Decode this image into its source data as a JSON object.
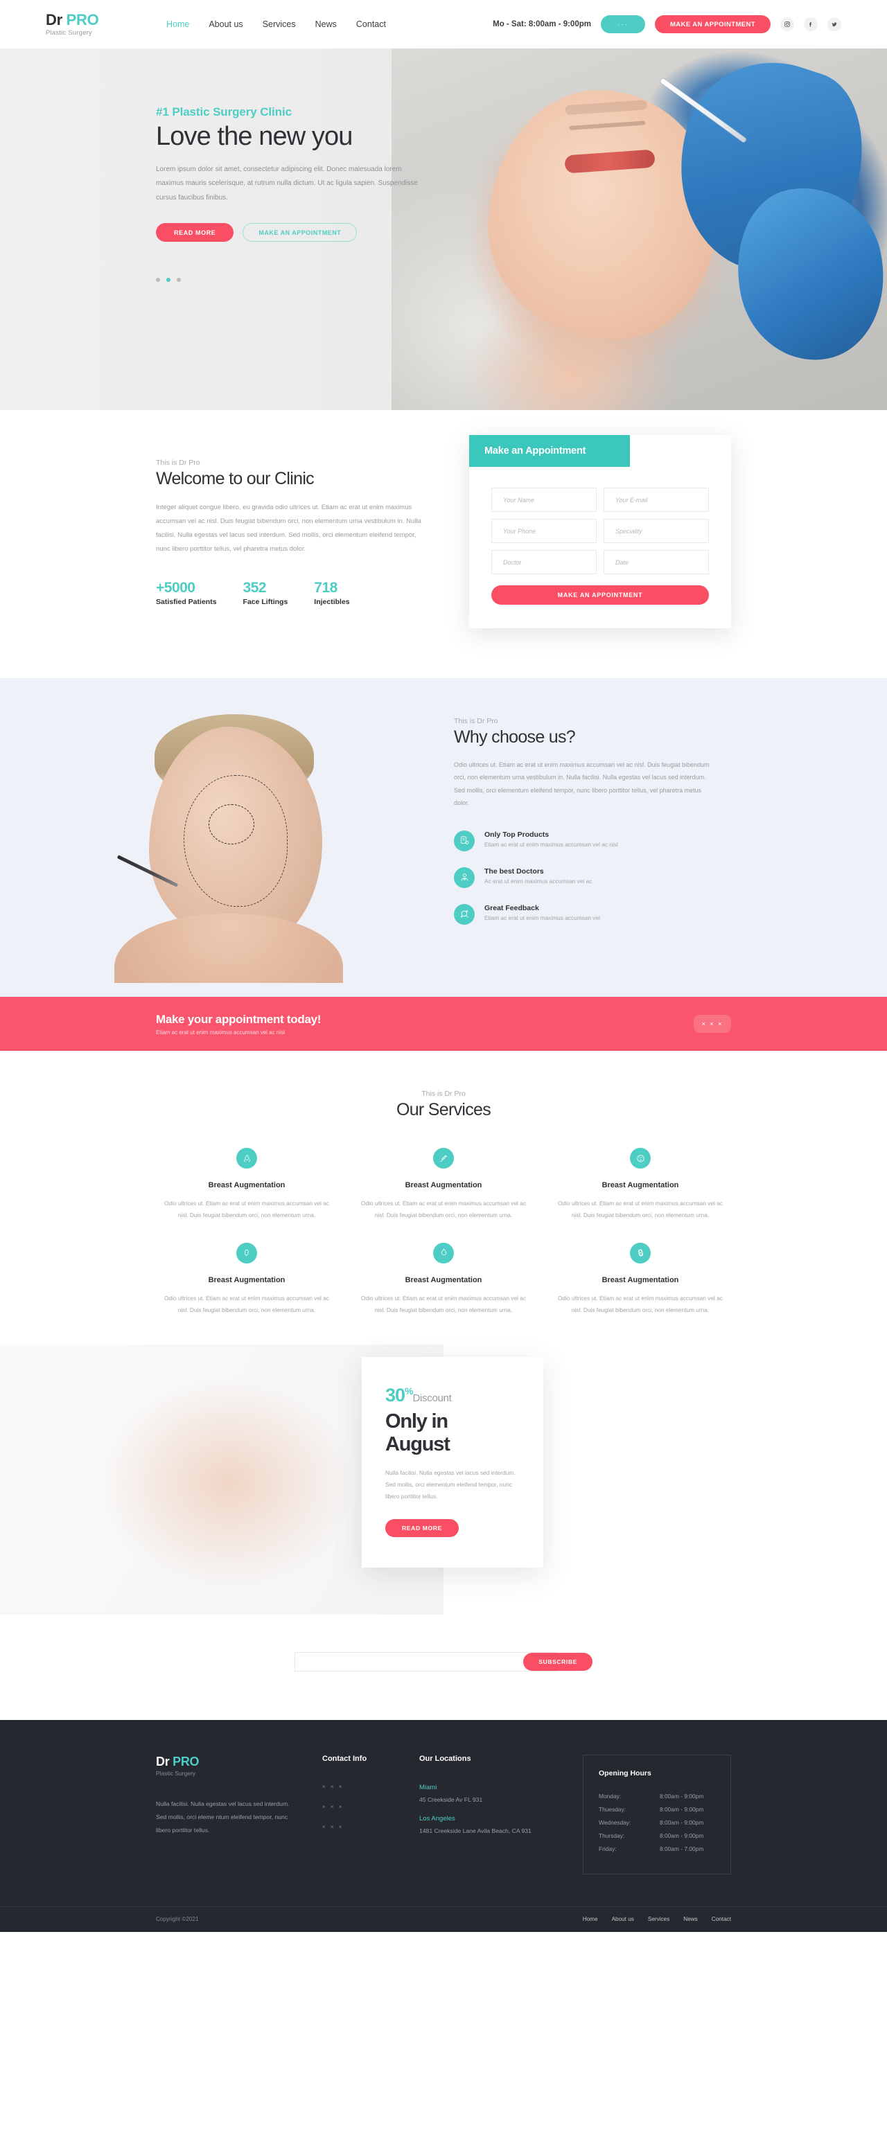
{
  "brand": {
    "name_first": "Dr",
    "name_second": "PRO",
    "tagline": "Plastic Surgery",
    "accent_teal": "#4ecdc4",
    "accent_pink": "#f94e63",
    "dark": "#25282e"
  },
  "header": {
    "nav": [
      {
        "label": "Home",
        "active": true
      },
      {
        "label": "About us",
        "active": false
      },
      {
        "label": "Services",
        "active": false
      },
      {
        "label": "News",
        "active": false
      },
      {
        "label": "Contact",
        "active": false
      }
    ],
    "hours": "Mo - Sat: 8:00am - 9:00pm",
    "dots_label": "···",
    "appointment_label": "MAKE AN APPOINTMENT",
    "socials": [
      {
        "name": "instagram-icon",
        "glyph": "□"
      },
      {
        "name": "facebook-icon",
        "glyph": "f"
      },
      {
        "name": "twitter-icon",
        "glyph": "✉"
      }
    ]
  },
  "hero": {
    "kicker": "#1 Plastic Surgery Clinic",
    "title": "Love the new you",
    "text": "Lorem ipsum dolor sit amet, consectetur adipiscing elit. Donec malesuada lorem maximus mauris scelerisque, at rutrum nulla dictum. Ut ac ligula sapien. Suspendisse cursus faucibus finibus.",
    "btn_primary": "READ MORE",
    "btn_secondary": "MAKE AN APPOINTMENT",
    "slider_active_index": 1,
    "slider_count": 3
  },
  "welcome": {
    "kicker": "This is Dr Pro",
    "title": "Welcome to our Clinic",
    "text": "Integer aliquet congue libero, eu gravida odio ultrices ut. Etiam ac erat ut enim maximus accumsan vel ac nisl. Duis feugiat bibendum orci, non elementum urna vestibulum in. Nulla facilisi. Nulla egestas vel lacus sed interdum. Sed mollis, orci elementum eleifend tempor, nunc libero porttitor tellus, vel pharetra metus dolor.",
    "stats": [
      {
        "value": "+5000",
        "label": "Satisfied Patients"
      },
      {
        "value": "352",
        "label": "Face Liftings"
      },
      {
        "value": "718",
        "label": "Injectibles"
      }
    ]
  },
  "appointment_form": {
    "heading": "Make an Appointment",
    "fields": [
      {
        "name": "name",
        "placeholder": "Your Name",
        "value": ""
      },
      {
        "name": "email",
        "placeholder": "Your E-mail",
        "value": ""
      },
      {
        "name": "phone",
        "placeholder": "Your Phone",
        "value": ""
      },
      {
        "name": "speciality",
        "placeholder": "Speciality",
        "value": ""
      },
      {
        "name": "doctor",
        "placeholder": "Doctor",
        "value": ""
      },
      {
        "name": "date",
        "placeholder": "Date",
        "value": ""
      }
    ],
    "submit_label": "MAKE AN APPOINTMENT"
  },
  "why": {
    "kicker": "This is Dr Pro",
    "title": "Why choose us?",
    "text": "Odio ultrices ut. Etiam ac erat ut enim maximus accumsan vel ac nisl. Duis feugiat bibendum orci, non elementum urna vestibulum in. Nulla facilisi. Nulla egestas vel lacus sed interdum. Sed mollis, orci elementum eleifend tempor, nunc libero porttitor tellus, vel pharetra metus dolor.",
    "features": [
      {
        "icon": "products-icon",
        "title": "Only Top Products",
        "sub": "Etiam ac erat ut enim maximus accumsan vel ac nisl"
      },
      {
        "icon": "doctor-icon",
        "title": "The best Doctors",
        "sub": "Ac erat ut enim maximus accumsan vel ac"
      },
      {
        "icon": "feedback-icon",
        "title": "Great Feedback",
        "sub": "Etiam ac erat ut enim maximus accumsan vel"
      }
    ]
  },
  "cta": {
    "title": "Make your appointment today!",
    "sub": "Etiam ac erat ut enim maximus accumsan vel ac nisl",
    "button_label": "× × ×"
  },
  "services": {
    "kicker": "This is Dr Pro",
    "title": "Our Services",
    "items": [
      {
        "icon": "breast-drop-icon",
        "title": "Breast Augmentation",
        "text": "Odio ultrices ut. Etiam ac erat ut enim maximus accumsan vel ac nisl. Duis feugiat bibendum orci, non elementum urna."
      },
      {
        "icon": "syringe-icon",
        "title": "Breast Augmentation",
        "text": "Odio ultrices ut. Etiam ac erat ut enim maximus accumsan vel ac nisl. Duis feugiat bibendum orci, non elementum urna."
      },
      {
        "icon": "face-scan-icon",
        "title": "Breast Augmentation",
        "text": "Odio ultrices ut. Etiam ac erat ut enim maximus accumsan vel ac nisl. Duis feugiat bibendum orci, non elementum urna."
      },
      {
        "icon": "implant-icon",
        "title": "Breast Augmentation",
        "text": "Odio ultrices ut. Etiam ac erat ut enim maximus accumsan vel ac nisl. Duis feugiat bibendum orci, non elementum urna."
      },
      {
        "icon": "droplet-icon",
        "title": "Breast Augmentation",
        "text": "Odio ultrices ut. Etiam ac erat ut enim maximus accumsan vel ac nisl. Duis feugiat bibendum orci, non elementum urna."
      },
      {
        "icon": "molecule-icon",
        "title": "Breast Augmentation",
        "text": "Odio ultrices ut. Etiam ac erat ut enim maximus accumsan vel ac nisl. Duis feugiat bibendum orci, non elementum urna."
      }
    ]
  },
  "discount": {
    "percent": "30",
    "percent_symbol": "%",
    "word": "Discount",
    "title_line1": "Only in",
    "title_line2": "August",
    "text": "Nulla facilisi. Nulla egestas vel lacus sed interdum. Sed mollis, orci elementum eleifend tempor, nunc libero porttitor tellus.",
    "button_label": "READ MORE"
  },
  "subscribe": {
    "placeholder": "",
    "value": "",
    "button_label": "SUBSCRIBE"
  },
  "footer": {
    "about_text": "Nulla facilisi. Nulla egestas vel lacus sed interdum. Sed mollis, orci eleme ntum eleifend tempor, nunc libero porttitor tellus.",
    "contact": {
      "heading": "Contact Info",
      "items": [
        "× × ×",
        "× × ×",
        "× × ×"
      ]
    },
    "locations": {
      "heading": "Our Locations",
      "items": [
        {
          "name": "Miami",
          "address": "45 Creekside Av FL 931"
        },
        {
          "name": "Los Angeles",
          "address": "1481 Creekside Lane Avila Beach, CA 931"
        }
      ]
    },
    "opening": {
      "heading": "Opening Hours",
      "rows": [
        {
          "day": "Monday:",
          "time": "8:00am - 9:00pm"
        },
        {
          "day": "Thuesday:",
          "time": "8:00am - 9:00pm"
        },
        {
          "day": "Wednesday:",
          "time": "8:00am - 9:00pm"
        },
        {
          "day": "Thursday:",
          "time": "8:00am - 9:00pm"
        },
        {
          "day": "Friday:",
          "time": "8:00am - 7:00pm"
        }
      ]
    },
    "copyright": "Copyright ©2021",
    "nav": [
      "Home",
      "About us",
      "Services",
      "News",
      "Contact"
    ]
  }
}
